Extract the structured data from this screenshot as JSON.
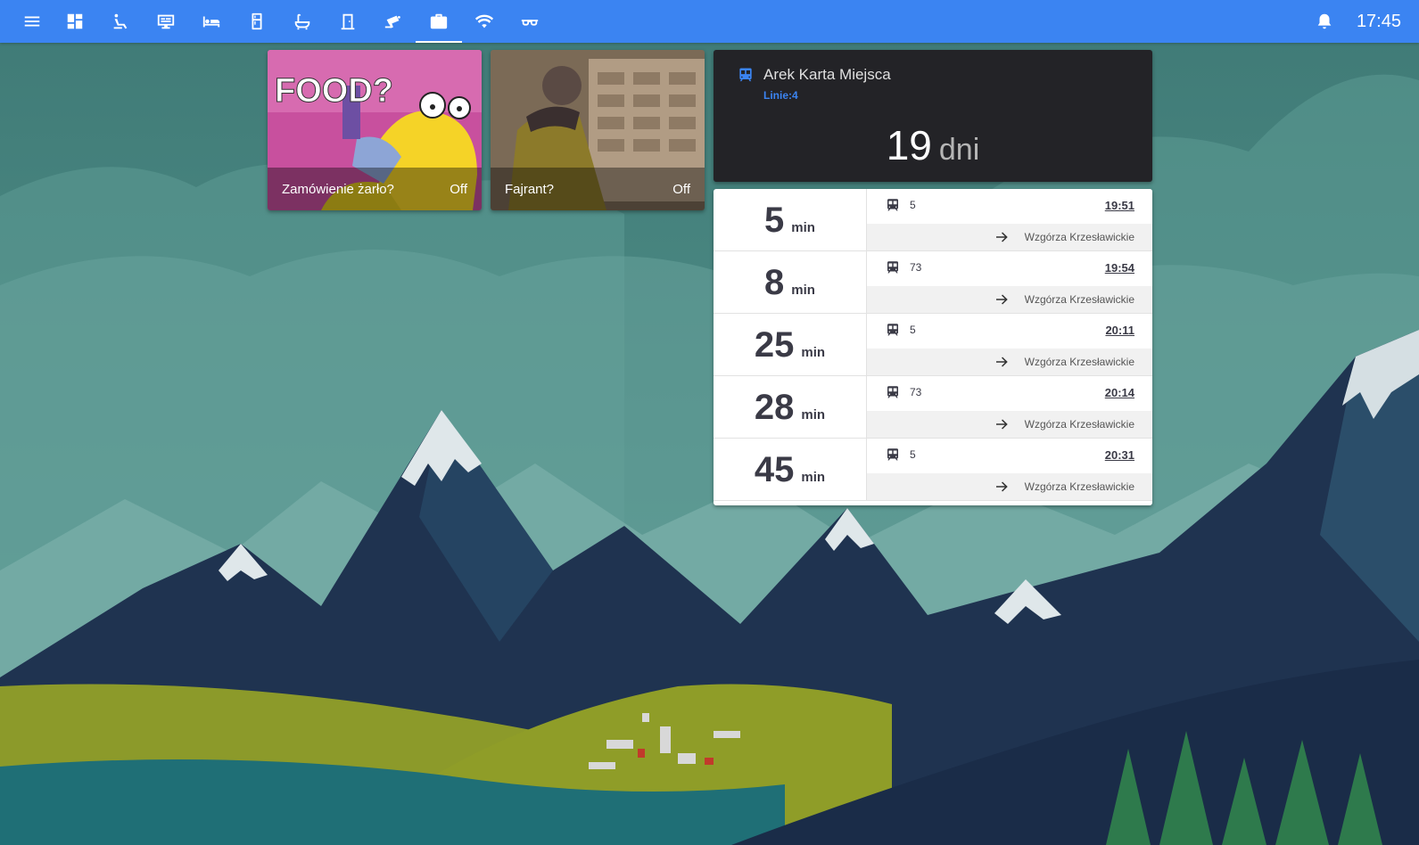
{
  "topbar": {
    "clock": "17:45",
    "icons": [
      "menu-icon",
      "dashboard-icon",
      "seat-icon",
      "desktop-icon",
      "bed-icon",
      "fridge-icon",
      "bathtub-icon",
      "door-icon",
      "cctv-icon",
      "briefcase-icon",
      "wifi-icon",
      "glasses-icon"
    ],
    "active_icon": "briefcase-icon",
    "bell_icon": "bell-icon"
  },
  "tiles": [
    {
      "label": "Zamówienie żarło?",
      "state": "Off",
      "image_text": "FOOD?"
    },
    {
      "label": "Fajrant?",
      "state": "Off"
    }
  ],
  "ticket": {
    "title": "Arek Karta Miejsca",
    "lines": "Linie:4",
    "days_value": "19",
    "days_unit": "dni"
  },
  "departures": [
    {
      "minutes": "5",
      "unit": "min",
      "line": "5",
      "time": "19:51",
      "destination": "Wzgórza Krzesławickie"
    },
    {
      "minutes": "8",
      "unit": "min",
      "line": "73",
      "time": "19:54",
      "destination": "Wzgórza Krzesławickie"
    },
    {
      "minutes": "25",
      "unit": "min",
      "line": "5",
      "time": "20:11",
      "destination": "Wzgórza Krzesławickie"
    },
    {
      "minutes": "28",
      "unit": "min",
      "line": "73",
      "time": "20:14",
      "destination": "Wzgórza Krzesławickie"
    },
    {
      "minutes": "45",
      "unit": "min",
      "line": "5",
      "time": "20:31",
      "destination": "Wzgórza Krzesławickie"
    }
  ],
  "colors": {
    "topbar": "#3b84f2",
    "accent": "#3b84f2",
    "card_dark": "#232327",
    "text_dark": "#3a3a46"
  }
}
